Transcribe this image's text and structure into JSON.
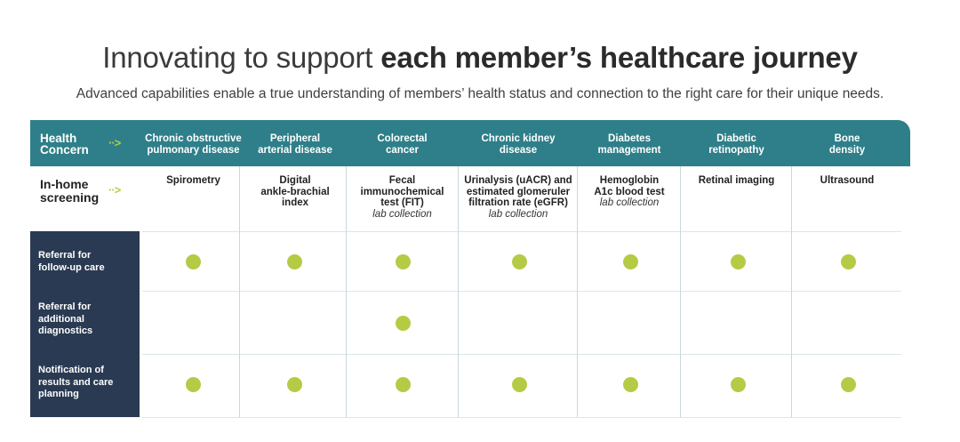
{
  "title": {
    "regular": "Innovating to support",
    "bold": "each member’s healthcare journey"
  },
  "subtitle": "Advanced capabilities enable a true understanding of members’ health status and connection to the right care for their unique needs.",
  "header": {
    "label_line1": "Health",
    "label_line2": "Concern",
    "arrow": "··>"
  },
  "columns": [
    {
      "line1": "Chronic obstructive",
      "line2": "pulmonary disease"
    },
    {
      "line1": "Peripheral",
      "line2": "arterial disease"
    },
    {
      "line1": "Colorectal",
      "line2": "cancer"
    },
    {
      "line1": "Chronic kidney",
      "line2": "disease"
    },
    {
      "line1": "Diabetes",
      "line2": "management"
    },
    {
      "line1": "Diabetic",
      "line2": "retinopathy"
    },
    {
      "line1": "Bone",
      "line2": "density"
    }
  ],
  "screening": {
    "label_line1": "In-home",
    "label_line2": "screening",
    "arrow": "··>",
    "cells": [
      {
        "l1": "Spirometry",
        "l2": "",
        "l3": "",
        "lab": ""
      },
      {
        "l1": "Digital",
        "l2": "ankle-brachial",
        "l3": "index",
        "lab": ""
      },
      {
        "l1": "Fecal",
        "l2": "immunochemical",
        "l3": "test  (FIT)",
        "lab": "lab collection"
      },
      {
        "l1": "Urinalysis (uACR) and",
        "l2": "estimated glomeruler",
        "l3": "filtration rate (eGFR)",
        "lab": "lab collection"
      },
      {
        "l1": "Hemoglobin",
        "l2": "A1c blood test",
        "l3": "",
        "lab": "lab collection"
      },
      {
        "l1": "Retinal imaging",
        "l2": "",
        "l3": "",
        "lab": ""
      },
      {
        "l1": "Ultrasound",
        "l2": "",
        "l3": "",
        "lab": ""
      }
    ]
  },
  "rows": [
    {
      "l1": "Referral for",
      "l2": "follow-up care",
      "l3": "",
      "dots": [
        true,
        true,
        true,
        true,
        true,
        true,
        true
      ]
    },
    {
      "l1": "Referral for",
      "l2": "additional",
      "l3": "diagnostics",
      "dots": [
        false,
        false,
        true,
        false,
        false,
        false,
        false
      ]
    },
    {
      "l1": "Notification of",
      "l2": "results and care",
      "l3": "planning",
      "dots": [
        true,
        true,
        true,
        true,
        true,
        true,
        true
      ]
    }
  ],
  "colors": {
    "header_teal": "#2e7f89",
    "row_navy": "#2a3a52",
    "dot_green": "#b5cb45",
    "arrow_green": "#b5cf3d"
  }
}
